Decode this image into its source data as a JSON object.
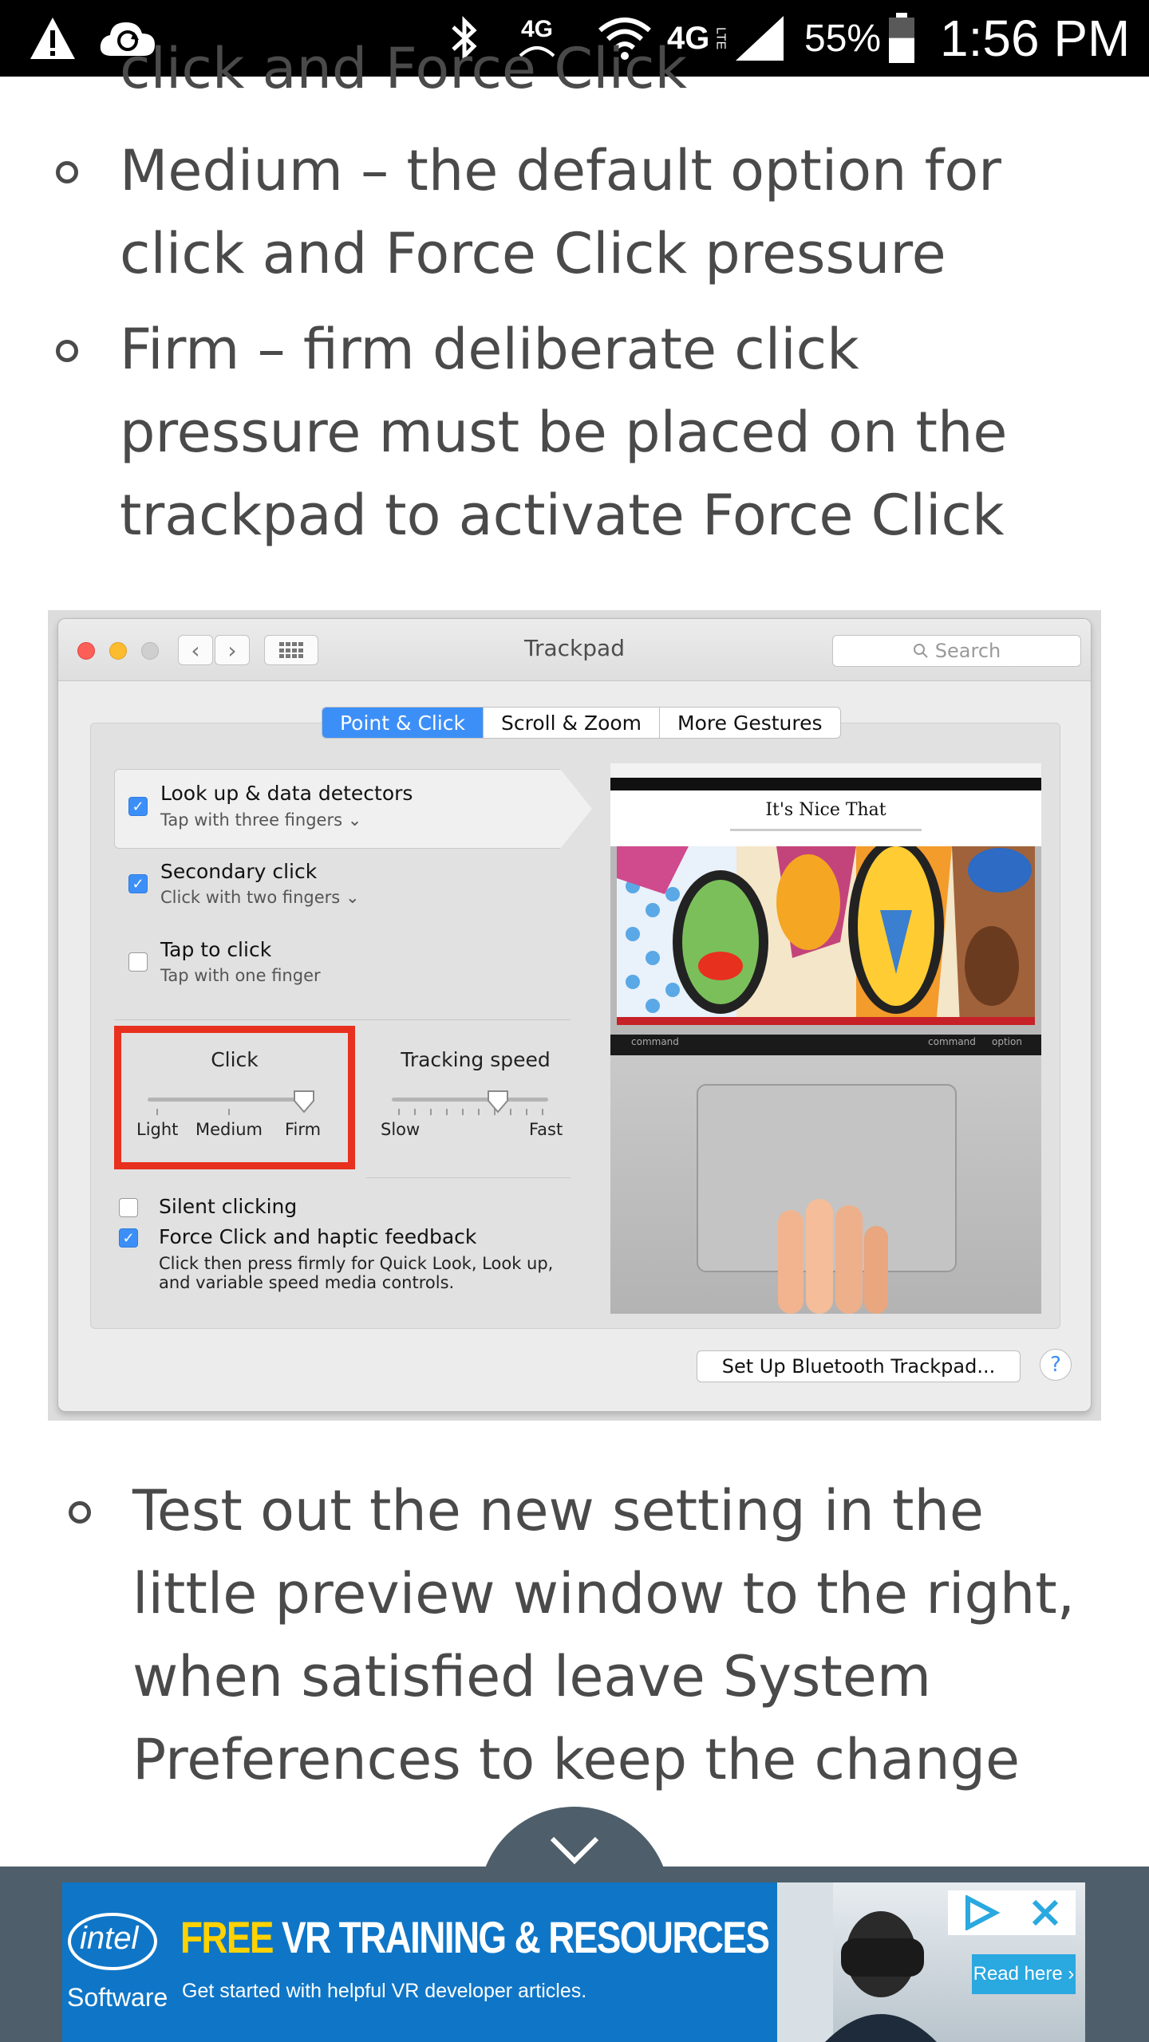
{
  "status_bar": {
    "battery_percent": "55%",
    "time": "1:56 PM",
    "network_label_1": "4G",
    "network_label_2": "4G",
    "lte_label": "LTE",
    "battery_level": 0.55
  },
  "article": {
    "partial_top_line": "click and Force Click",
    "bullets": [
      {
        "lines": [
          "Medium – the default option for",
          "click and Force Click pressure"
        ]
      },
      {
        "lines": [
          "Firm – firm deliberate click",
          "pressure must be placed on the",
          "trackpad to activate Force Click"
        ]
      }
    ],
    "after_bullet": {
      "lines": [
        "Test out the new setting in the",
        "little preview window to the right,",
        "when satisfied leave System",
        "Preferences to keep the change"
      ]
    }
  },
  "mac_window": {
    "title": "Trackpad",
    "search_placeholder": "Search",
    "tabs": [
      "Point & Click",
      "Scroll & Zoom",
      "More Gestures"
    ],
    "active_tab": "Point & Click",
    "options": [
      {
        "title": "Look up & data detectors",
        "subtitle": "Tap with three fingers",
        "checked": true,
        "has_dropdown": true
      },
      {
        "title": "Secondary click",
        "subtitle": "Click with two fingers",
        "checked": true,
        "has_dropdown": true
      },
      {
        "title": "Tap to click",
        "subtitle": "Tap with one finger",
        "checked": false,
        "has_dropdown": false
      }
    ],
    "click_slider": {
      "label": "Click",
      "ticks": [
        "Light",
        "Medium",
        "Firm"
      ],
      "selected": "Firm"
    },
    "tracking_slider": {
      "label": "Tracking speed",
      "min_label": "Slow",
      "max_label": "Fast",
      "level": 0.68
    },
    "silent_clicking": {
      "label": "Silent clicking",
      "checked": false
    },
    "force_click": {
      "label": "Force Click and haptic feedback",
      "checked": true,
      "description_lines": [
        "Click then press firmly for Quick Look, Look up,",
        "and variable speed media controls."
      ]
    },
    "preview": {
      "site_name": "It's Nice That",
      "key_label_1": "command",
      "key_label_2": "command",
      "key_label_3": "option"
    },
    "bluetooth_button": "Set Up Bluetooth Trackpad...",
    "help_button": "?"
  },
  "ad": {
    "brand_top": "intel",
    "brand_bottom": "Software",
    "headline_free": "FREE",
    "headline_rest": "VR TRAINING & RESOURCES FROM INTEL",
    "subline": "Get started with helpful VR developer articles.",
    "cta": "Read here ›"
  },
  "colors": {
    "accent_blue": "#3d8ff8",
    "highlight_red": "#e8301f",
    "ad_blue": "#0f76c7",
    "ad_yellow": "#ffd200",
    "bottom_bar": "#4e5f6b"
  }
}
